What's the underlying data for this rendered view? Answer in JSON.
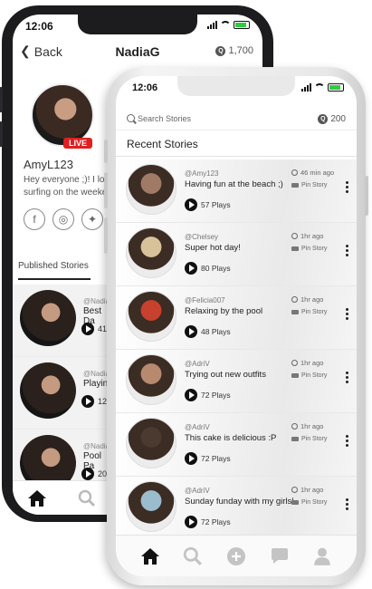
{
  "back_phone": {
    "status_time": "12:06",
    "header": {
      "back_label": "Back",
      "title": "NadiaG",
      "coins": "1,700"
    },
    "profile": {
      "live_badge": "LIVE",
      "name": "AmyL123",
      "bio": "Hey everyone ;)!  I love\nsurfing on the weekend"
    },
    "tabs": {
      "published": "Published Stories"
    },
    "stories": [
      {
        "user": "@Nadia",
        "title": "Best Da",
        "plays": "41"
      },
      {
        "user": "@Nadia",
        "title": "Playing",
        "plays": "12"
      },
      {
        "user": "@Nadia",
        "title": "Pool Pa",
        "plays": "20"
      }
    ]
  },
  "front_phone": {
    "status_time": "12:06",
    "search": {
      "placeholder": "Search Stories",
      "coins": "200"
    },
    "section_title": "Recent Stories",
    "stories": [
      {
        "user": "@Amy123",
        "title": "Having fun at the beach ;)",
        "plays": "57 Plays",
        "time": "46 min ago",
        "type": "Pin Story",
        "avatar_color": "#a07a66"
      },
      {
        "user": "@Chelsey",
        "title": "Super hot day!",
        "plays": "80 Plays",
        "time": "1hr ago",
        "type": "Pin Story",
        "avatar_color": "#d8c29a"
      },
      {
        "user": "@Felicia007",
        "title": "Relaxing by the pool",
        "plays": "48 Plays",
        "time": "1hr ago",
        "type": "Pin Story",
        "avatar_color": "#c8402e"
      },
      {
        "user": "@AdriV",
        "title": "Trying out new outfits",
        "plays": "72 Plays",
        "time": "1hr ago",
        "type": "Pin Story",
        "avatar_color": "#b78a70"
      },
      {
        "user": "@AdriV",
        "title": "This cake is delicious :P",
        "plays": "72 Plays",
        "time": "1hr ago",
        "type": "Pin Story",
        "avatar_color": "#4a3a30"
      },
      {
        "user": "@AdriV",
        "title": "Sunday funday with my girls!",
        "plays": "72 Plays",
        "time": "1hr ago",
        "type": "Pin Story",
        "avatar_color": "#9bbccc"
      }
    ],
    "nav": [
      "home-icon",
      "search-icon",
      "add-icon",
      "chat-icon",
      "profile-icon"
    ]
  }
}
